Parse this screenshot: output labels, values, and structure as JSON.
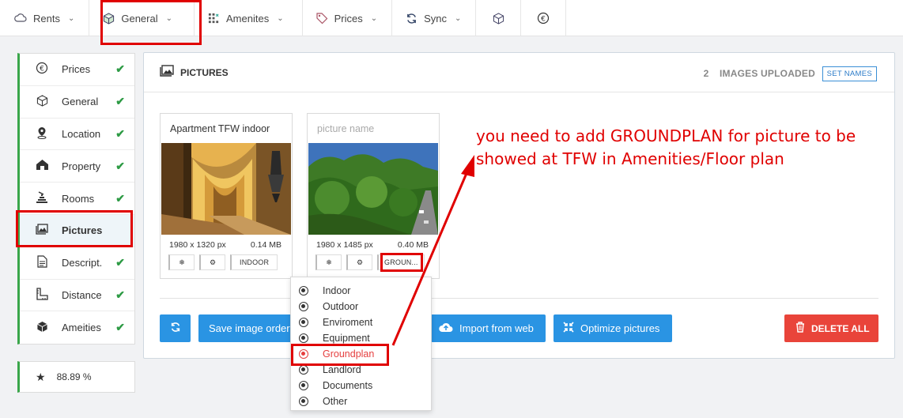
{
  "topnav": {
    "items": [
      {
        "label": "Rents",
        "icon": "cloud-icon"
      },
      {
        "label": "General",
        "icon": "cube-icon"
      },
      {
        "label": "Amenites",
        "icon": "grid-icon"
      },
      {
        "label": "Prices",
        "icon": "tag-icon"
      },
      {
        "label": "Sync",
        "icon": "sync-icon"
      }
    ],
    "extra_icons": [
      "cube-icon",
      "euro-icon"
    ]
  },
  "sidebar": {
    "items": [
      {
        "label": "Prices",
        "icon": "euro-icon",
        "done": true
      },
      {
        "label": "General",
        "icon": "cube-icon",
        "done": true
      },
      {
        "label": "Location",
        "icon": "pin-icon",
        "done": true
      },
      {
        "label": "Property",
        "icon": "home-icon",
        "done": true
      },
      {
        "label": "Rooms",
        "icon": "stairs-icon",
        "done": true
      },
      {
        "label": "Pictures",
        "icon": "pictures-icon",
        "done": false,
        "active": true
      },
      {
        "label": "Descript.",
        "icon": "document-icon",
        "done": true
      },
      {
        "label": "Distance",
        "icon": "ruler-icon",
        "done": true
      },
      {
        "label": "Ameities",
        "icon": "box-icon",
        "done": true
      }
    ],
    "score": "88.89 %"
  },
  "panel": {
    "title": "PICTURES",
    "uploaded_count": "2",
    "uploaded_label": "IMAGES UPLOADED",
    "set_names": "SET NAMES",
    "cards": [
      {
        "name": "Apartment TFW indoor",
        "placeholder": "",
        "dims": "1980 x 1320 px",
        "size": "0.14 MB",
        "tag": "INDOOR"
      },
      {
        "name": "",
        "placeholder": "picture name",
        "dims": "1980 x 1485 px",
        "size": "0.40 MB",
        "tag": "GROUN..."
      }
    ],
    "buttons": {
      "order": "Save image order",
      "import": "Import from web",
      "optimize": "Optimize pictures",
      "delete": "DELETE ALL"
    }
  },
  "dropdown": {
    "options": [
      "Indoor",
      "Outdoor",
      "Enviroment",
      "Equipment",
      "Groundplan",
      "Landlord",
      "Documents",
      "Other"
    ],
    "selected": "Groundplan"
  },
  "annotation": {
    "line1": "you need to add GROUNDPLAN for picture to be",
    "line2": "showed at TFW in Amenities/Floor plan",
    "color": "#e00000"
  },
  "colors": {
    "accent": "#2a94e3",
    "success": "#2e9b45",
    "danger": "#e9443a"
  }
}
